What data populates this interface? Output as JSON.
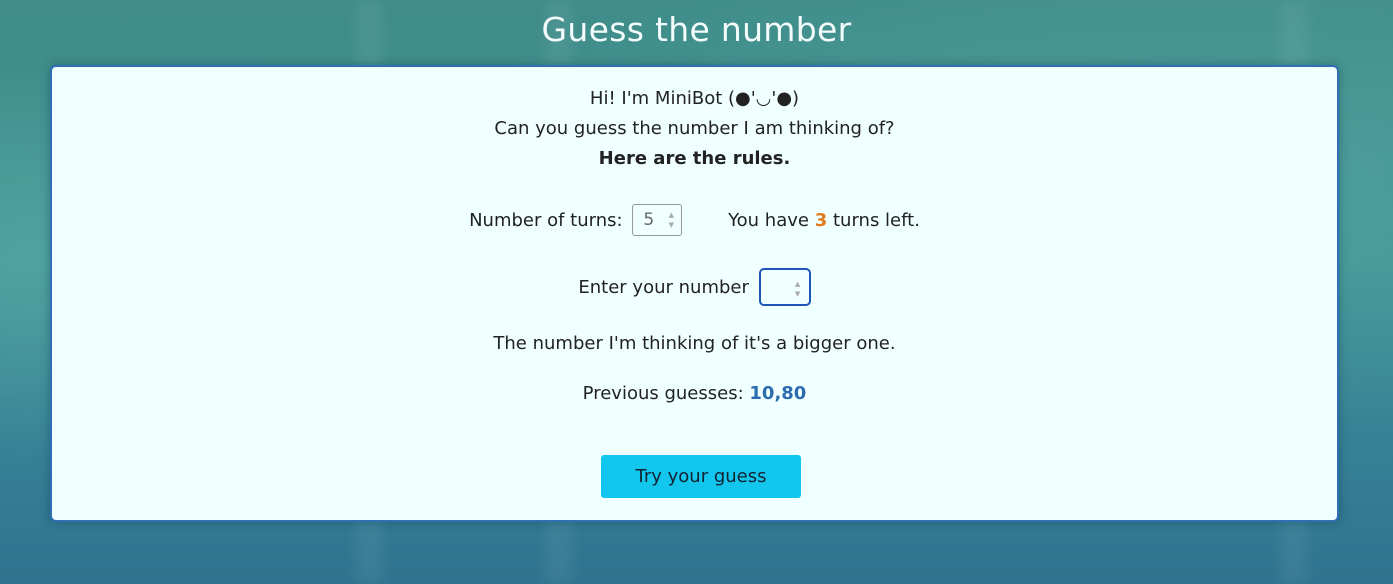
{
  "page": {
    "title": "Guess the number"
  },
  "intro": {
    "greeting": "Hi! I'm MiniBot (●'◡'●)",
    "question": "Can you guess the number I am thinking of?",
    "rules_link": "Here are the rules."
  },
  "turns": {
    "label": "Number of turns:",
    "value": "5",
    "left_prefix": "You have",
    "left_count": "3",
    "left_suffix": "turns left."
  },
  "guess_input": {
    "label": "Enter your number",
    "value": ""
  },
  "hint": {
    "text": "The number I'm thinking of it's a bigger one."
  },
  "previous": {
    "label": "Previous guesses:",
    "values": "10,80"
  },
  "actions": {
    "try_label": "Try your guess"
  },
  "colors": {
    "accent_button": "#12c6ee",
    "turns_count": "#e07a1f",
    "previous_values": "#2a6cae",
    "focus_border": "#1e56b8"
  }
}
